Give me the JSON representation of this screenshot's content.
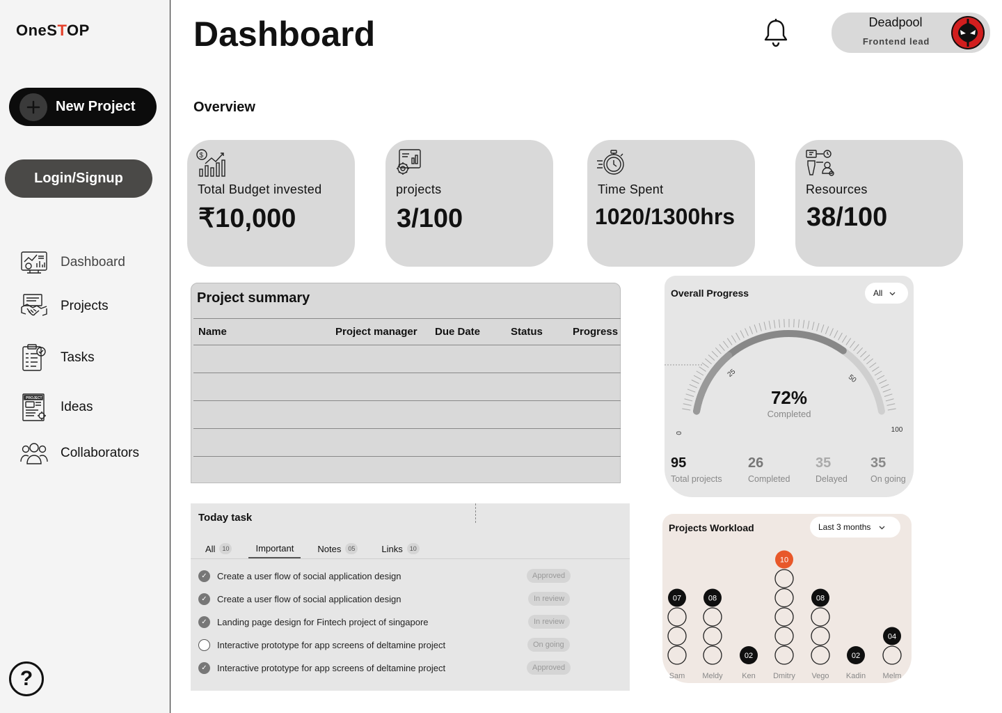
{
  "sidebar": {
    "logo_a": "OneS",
    "logo_accent": "T",
    "logo_b": "OP",
    "new_project": "New Project",
    "login": "Login/Signup",
    "items": [
      {
        "label": "Dashboard",
        "icon": "dashboard-icon"
      },
      {
        "label": "Projects",
        "icon": "handshake-icon"
      },
      {
        "label": "Tasks",
        "icon": "clipboard-check-icon"
      },
      {
        "label": "Ideas",
        "icon": "project-ideas-icon"
      },
      {
        "label": "Collaborators",
        "icon": "group-users-icon"
      }
    ],
    "help": "?"
  },
  "header": {
    "title": "Dashboard",
    "user_name": "Deadpool",
    "user_role": "Frontend lead"
  },
  "overview": {
    "title": "Overview",
    "cards": [
      {
        "label": "Total Budget invested",
        "value": "₹10,000",
        "icon": "budget-chart-icon"
      },
      {
        "label": "projects",
        "value": "3/100",
        "icon": "project-gear-icon"
      },
      {
        "label": "Time Spent",
        "value": "1020/1300hrs",
        "icon": "stopwatch-icon"
      },
      {
        "label": "Resources",
        "value": "38/100",
        "icon": "resources-icon"
      }
    ]
  },
  "summary": {
    "title": "Project summary",
    "columns": [
      "Name",
      "Project manager",
      "Due Date",
      "Status",
      "Progress"
    ],
    "row_count": 5
  },
  "today": {
    "title": "Today task",
    "tabs": [
      {
        "label": "All",
        "count": "10"
      },
      {
        "label": "Important",
        "count": ""
      },
      {
        "label": "Notes",
        "count": "05"
      },
      {
        "label": "Links",
        "count": "10"
      }
    ],
    "tasks": [
      {
        "text": "Create a user flow of social application design",
        "status": "Approved",
        "done": true
      },
      {
        "text": "Create a user flow of social application design",
        "status": "In review",
        "done": true
      },
      {
        "text": "Landing page design for Fintech project of singapore",
        "status": "In review",
        "done": true
      },
      {
        "text": "Interactive prototype for app screens of deltamine project",
        "status": "On going",
        "done": false
      },
      {
        "text": "Interactive prototype for app screens of deltamine project",
        "status": "Approved",
        "done": true
      }
    ]
  },
  "progress": {
    "title": "Overall Progress",
    "filter": "All",
    "percent_label": "72%",
    "percent": 72,
    "sub": "Completed",
    "tick_labels": [
      "0",
      "25",
      "50",
      "100"
    ],
    "stats": [
      {
        "value": "95",
        "label": "Total projects"
      },
      {
        "value": "26",
        "label": "Completed"
      },
      {
        "value": "35",
        "label": "Delayed"
      },
      {
        "value": "35",
        "label": "On going"
      }
    ]
  },
  "workload": {
    "title": "Projects Workload",
    "filter": "Last 3 months",
    "colors": {
      "highlight": "#e8582a",
      "filled": "#0f0f0f"
    },
    "people": [
      {
        "name": "Sam",
        "count": 7,
        "label": "07"
      },
      {
        "name": "Meldy",
        "count": 8,
        "label": "08"
      },
      {
        "name": "Ken",
        "count": 2,
        "label": "02"
      },
      {
        "name": "Dmitry",
        "count": 10,
        "label": "10"
      },
      {
        "name": "Vego",
        "count": 8,
        "label": "08"
      },
      {
        "name": "Kadin",
        "count": 2,
        "label": "02"
      },
      {
        "name": "Melm",
        "count": 4,
        "label": "04"
      }
    ]
  }
}
